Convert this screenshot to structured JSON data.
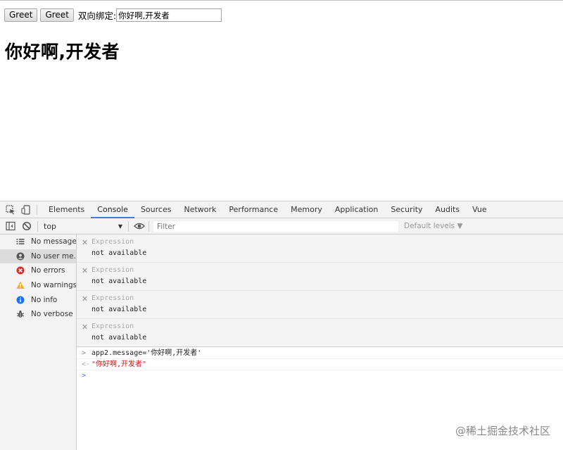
{
  "page": {
    "buttons": [
      "Greet",
      "Greet"
    ],
    "binding_label": "双向绑定:",
    "binding_input_value": "你好啊,开发者",
    "heading": "你好啊,开发者"
  },
  "devtools": {
    "tabs": [
      "Elements",
      "Console",
      "Sources",
      "Network",
      "Performance",
      "Memory",
      "Application",
      "Security",
      "Audits",
      "Vue"
    ],
    "active_tab": "Console",
    "context": "top",
    "filter_placeholder": "Filter",
    "levels_label": "Default levels ▼",
    "sidebar": [
      {
        "label": "No messages",
        "icon": "list-icon"
      },
      {
        "label": "No user me...",
        "icon": "user-icon"
      },
      {
        "label": "No errors",
        "icon": "error-icon"
      },
      {
        "label": "No warnings",
        "icon": "warning-icon"
      },
      {
        "label": "No info",
        "icon": "info-icon"
      },
      {
        "label": "No verbose",
        "icon": "bug-icon"
      }
    ],
    "expressions": [
      {
        "name": "Expression",
        "value": "not available"
      },
      {
        "name": "Expression",
        "value": "not available"
      },
      {
        "name": "Expression",
        "value": "not available"
      },
      {
        "name": "Expression",
        "value": "not available"
      }
    ],
    "log": [
      {
        "prefix": ">",
        "text": "app2.message='你好啊,开发者'"
      },
      {
        "prefix": "<·",
        "text": "\"你好啊,开发者\""
      },
      {
        "prefix": ">",
        "text": ""
      }
    ],
    "colors": {
      "string": "#c41a16",
      "accent": "#3b7ddb"
    }
  },
  "watermark": "@稀土掘金技术社区"
}
